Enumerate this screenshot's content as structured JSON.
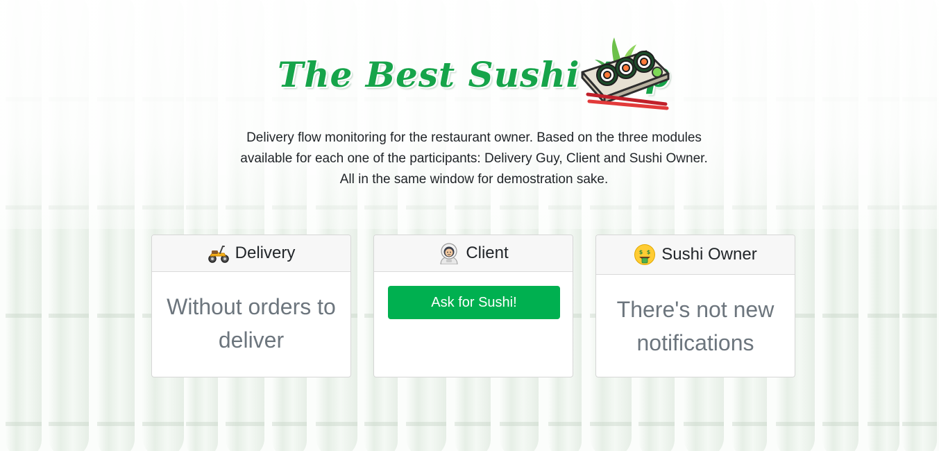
{
  "header": {
    "title": "The Best Sushi App",
    "logo_icon": "sushi-plate-icon"
  },
  "description": "Delivery flow monitoring for the restaurant owner. Based on the three modules available for each one of the participants: Delivery Guy, Client and Sushi Owner. All in the same window for demostration sake.",
  "colors": {
    "brand_green": "#16a44a",
    "button_green": "#00b050",
    "muted_text": "#6c757d"
  },
  "cards": {
    "delivery": {
      "icon": "scooter-icon",
      "title": "Delivery",
      "message": "Without orders to deliver"
    },
    "client": {
      "icon": "astronaut-icon",
      "title": "Client",
      "button_label": "Ask for Sushi!"
    },
    "owner": {
      "icon": "money-mouth-face-icon",
      "title": "Sushi Owner",
      "message": "There's not new notifications"
    }
  }
}
